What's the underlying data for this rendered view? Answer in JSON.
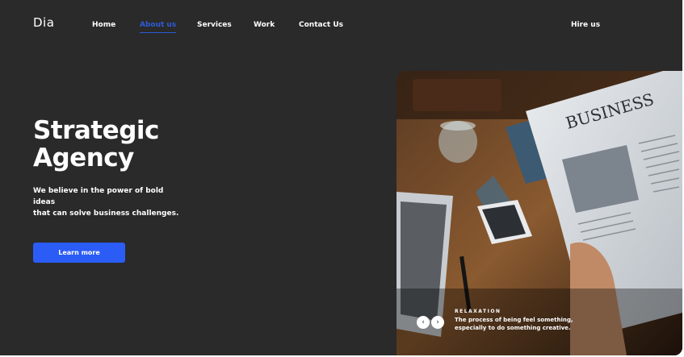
{
  "brand": {
    "logo": "Dia"
  },
  "nav": {
    "items": [
      {
        "label": "Home"
      },
      {
        "label": "About us",
        "active": true
      },
      {
        "label": "Services"
      },
      {
        "label": "Work"
      },
      {
        "label": "Contact Us"
      }
    ],
    "cta_label": "Hire us"
  },
  "hero": {
    "title_line1": "Strategic",
    "title_line2": "Agency",
    "subtitle_line1": "We believe in the power of bold ideas",
    "subtitle_line2": "that can solve business challenges.",
    "button_label": "Learn more"
  },
  "slide": {
    "newspaper_headline": "BUSINESS",
    "tag": "RELAXATION",
    "text_line1": "The process of being feel something,",
    "text_line2": "especially to do something creative.",
    "prev_icon": "chevron-left-icon",
    "next_icon": "chevron-right-icon"
  },
  "colors": {
    "background": "#2a2a2a",
    "accent": "#2b5cf6",
    "active_link": "#2d5bd8",
    "text": "#ffffff"
  }
}
